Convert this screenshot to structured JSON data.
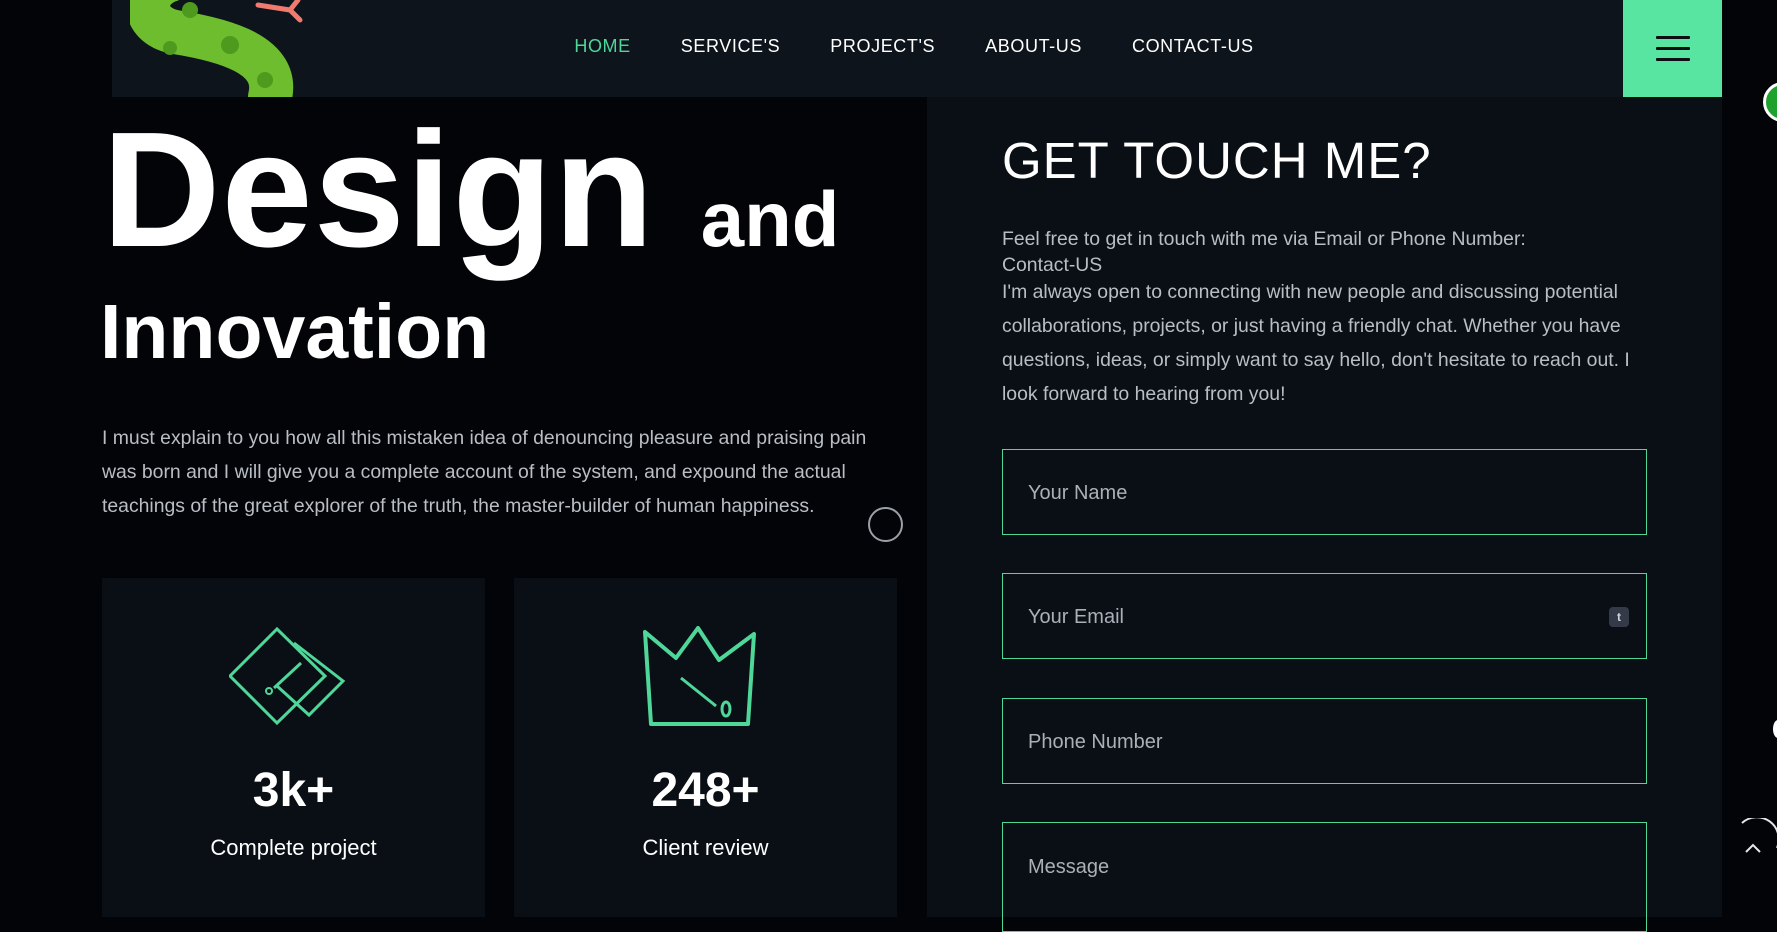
{
  "nav": {
    "links": [
      {
        "label": "HOME",
        "active": true
      },
      {
        "label": "SERVICE'S"
      },
      {
        "label": "PROJECT'S"
      },
      {
        "label": "ABOUT-US"
      },
      {
        "label": "CONTACT-US"
      }
    ],
    "menu_icon": "hamburger-icon",
    "logo_icon": "snake-icon"
  },
  "hero": {
    "title_big": "Design",
    "title_and": "and",
    "title_line2": "Innovation",
    "intro": "I must explain to you how all this mistaken idea of denouncing pleasure and praising pain was born and I will give you a complete account of the system, and expound the actual teachings of the great explorer of the truth, the master-builder of human happiness."
  },
  "stats": [
    {
      "icon": "diamond-icon",
      "value": "3k+",
      "label": "Complete project"
    },
    {
      "icon": "crown-icon",
      "value": "248+",
      "label": "Client review"
    }
  ],
  "contact": {
    "title": "GET TOUCH ME?",
    "line1": "Feel free to get in touch with me via Email or Phone Number:",
    "line2": "Contact-US",
    "body": "I'm always open to connecting with new people and discussing potential collaborations, projects, or just having a friendly chat. Whether you have questions, ideas, or simply want to say hello, don't hesitate to reach out. I look forward to hearing from you!",
    "fields": {
      "name": "Your Name",
      "email": "Your Email",
      "phone": "Phone Number",
      "message": "Message"
    },
    "email_badge": "t"
  },
  "colors": {
    "accent": "#4fd79a",
    "menu_bg": "#58e4a1",
    "nav_bg": "#0e141c",
    "panel_bg": "#0a0f15",
    "page_bg": "#020408"
  }
}
